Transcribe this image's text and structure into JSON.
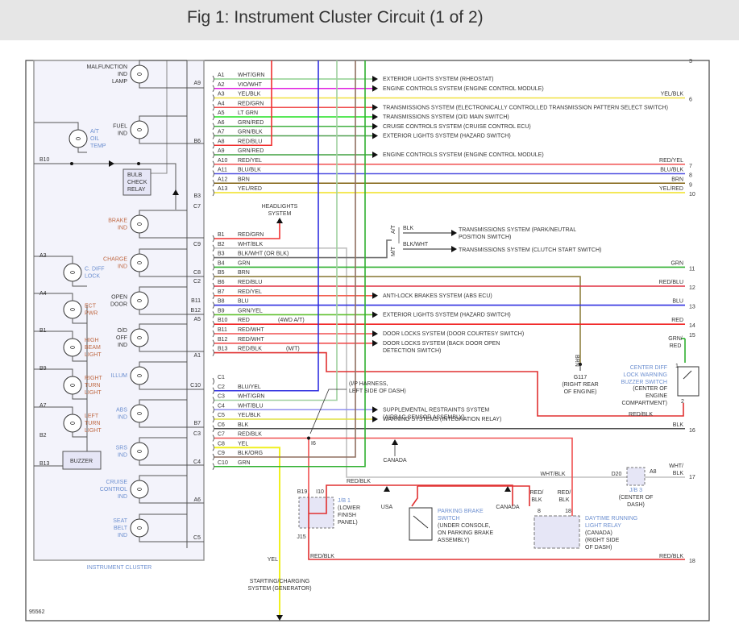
{
  "header": {
    "title": "Fig 1: Instrument Cluster Circuit (1 of 2)"
  },
  "figure_id": "95562",
  "cluster": {
    "label": "INSTRUMENT CLUSTER",
    "indicators": [
      {
        "name": "MALFUNCTION|IND|LAMP"
      },
      {
        "name": "FUEL|IND"
      },
      {
        "name": "A/T|OIL|TEMP"
      },
      {
        "name": "BRAKE|IND"
      },
      {
        "name": "CHARGE|IND"
      },
      {
        "name": "C. DIFF|LOCK"
      },
      {
        "name": "ECT|PWR"
      },
      {
        "name": "OPEN|DOOR"
      },
      {
        "name": "O/D|OFF|IND"
      },
      {
        "name": "HIGH|BEAM|LIGHT"
      },
      {
        "name": "ILLUM"
      },
      {
        "name": "RIGHT|TURN|LIGHT"
      },
      {
        "name": "ABS|IND"
      },
      {
        "name": "LEFT|TURN|LIGHT"
      },
      {
        "name": "SRS|IND"
      },
      {
        "name": "CRUISE|CONTROL|IND"
      },
      {
        "name": "SEAT|BELT|IND"
      }
    ],
    "bulb_check_relay": "BULB|CHECK|RELAY",
    "buzzer": "BUZZER",
    "right_pins": [
      "A9",
      "B6",
      "B3",
      "C7",
      "C9",
      "C8",
      "C2",
      "B11",
      "B12",
      "A5",
      "A1",
      "C10",
      "B7",
      "C3",
      "C4",
      "A6",
      "C5"
    ],
    "left_pins": [
      "B10",
      "A3",
      "A4",
      "B1",
      "B9",
      "A7",
      "B2",
      "B13"
    ]
  },
  "connectors": [
    {
      "pin": "A1",
      "wire": "WHT/GRN",
      "color": "#8fd08f",
      "dest": "EXTERIOR LIGHTS SYSTEM (RHEOSTAT)"
    },
    {
      "pin": "A2",
      "wire": "VIO/WHT",
      "color": "#e020e0",
      "dest": "ENGINE CONTROLS SYSTEM (ENGINE CONTROL MODULE)"
    },
    {
      "pin": "A3",
      "wire": "YEL/BLK",
      "color": "#f0e040",
      "right": "YEL/BLK",
      "num": "6"
    },
    {
      "pin": "A4",
      "wire": "RED/GRN",
      "color": "#f05050",
      "dest": "TRANSMISSIONS SYSTEM (ELECTRONICALLY CONTROLLED TRANSMISSION PATTERN SELECT SWITCH)"
    },
    {
      "pin": "A5",
      "wire": "LT GRN",
      "color": "#20e020",
      "dest": "TRANSMISSIONS SYSTEM (O/D MAIN SWITCH)"
    },
    {
      "pin": "A6",
      "wire": "GRN/RED",
      "color": "#40b040",
      "dest": "CRUISE CONTROLS SYSTEM (CRUISE CONTROL ECU)"
    },
    {
      "pin": "A7",
      "wire": "GRN/BLK",
      "color": "#50a050",
      "dest": "EXTERIOR LIGHTS SYSTEM (HAZARD SWITCH)"
    },
    {
      "pin": "A8",
      "wire": "RED/BLU",
      "color": "#f03030"
    },
    {
      "pin": "A9",
      "wire": "GRN/RED",
      "color": "#40a040",
      "dest": "ENGINE CONTROLS SYSTEM (ENGINE CONTROL MODULE)"
    },
    {
      "pin": "A10",
      "wire": "RED/YEL",
      "color": "#f05050",
      "right": "RED/YEL",
      "num": "7"
    },
    {
      "pin": "A11",
      "wire": "BLU/BLK",
      "color": "#5050e0",
      "right": "BLU/BLK",
      "num": "8"
    },
    {
      "pin": "A12",
      "wire": "BRN",
      "color": "#806010",
      "right": "BRN",
      "num": "9"
    },
    {
      "pin": "A13",
      "wire": "YEL/RED",
      "color": "#f0e020",
      "right": "YEL/RED",
      "num": "10"
    },
    {
      "pin": "B1",
      "wire": "RED/GRN",
      "color": "#f03030"
    },
    {
      "pin": "B2",
      "wire": "WHT/BLK",
      "color": "#c0c0c0"
    },
    {
      "pin": "B3",
      "wire": "BLK/WHT (OR BLK)",
      "color": "#707070"
    },
    {
      "pin": "B4",
      "wire": "GRN",
      "color": "#30b030",
      "right": "GRN",
      "num": "11"
    },
    {
      "pin": "B5",
      "wire": "BRN",
      "color": "#908040"
    },
    {
      "pin": "B6",
      "wire": "RED/BLU",
      "color": "#e03040",
      "right": "RED/BLU",
      "num": "12"
    },
    {
      "pin": "B7",
      "wire": "RED/YEL",
      "color": "#f06050",
      "dest": "ANTI-LOCK BRAKES SYSTEM (ABS ECU)"
    },
    {
      "pin": "B8",
      "wire": "BLU",
      "color": "#3030e0",
      "right": "BLU",
      "num": "13"
    },
    {
      "pin": "B9",
      "wire": "GRN/YEL",
      "color": "#60c030",
      "dest": "EXTERIOR LIGHTS SYSTEM (HAZARD SWITCH)"
    },
    {
      "pin": "B10",
      "wire": "RED",
      "color": "#f02020",
      "note": "(4WD A/T)",
      "right": "RED",
      "num": "14"
    },
    {
      "pin": "B11",
      "wire": "RED/WHT",
      "color": "#f05050",
      "dest": "DOOR LOCKS SYSTEM (DOOR COURTESY SWITCH)"
    },
    {
      "pin": "B12",
      "wire": "RED/WHT",
      "color": "#f05050",
      "dest": "DOOR LOCKS SYSTEM (BACK DOOR OPEN|DETECTION SWITCH)"
    },
    {
      "pin": "B13",
      "wire": "RED/BLK",
      "color": "#e03030",
      "note": "(M/T)"
    },
    {
      "pin": "C1",
      "wire": "",
      "color": ""
    },
    {
      "pin": "C2",
      "wire": "BLU/YEL",
      "color": "#3030e0"
    },
    {
      "pin": "C3",
      "wire": "WHT/GRN",
      "color": "#a0d0a0"
    },
    {
      "pin": "C4",
      "wire": "WHT/BLU",
      "color": "#9090f0",
      "dest": "SUPPLEMENTAL RESTRAINTS SYSTEM|(AIRBAG SENSOR ASSEMBLY)"
    },
    {
      "pin": "C5",
      "wire": "YEL/BLK",
      "color": "#e0e040",
      "dest": "WARNING SYSTEMS (INTEGRATION RELAY)"
    },
    {
      "pin": "C6",
      "wire": "BLK",
      "color": "#505050",
      "right": "BLK",
      "num": "16"
    },
    {
      "pin": "C7",
      "wire": "RED/BLK",
      "color": "#f05050"
    },
    {
      "pin": "C8",
      "wire": "YEL",
      "color": "#f0f020"
    },
    {
      "pin": "C9",
      "wire": "BLK/ORG",
      "color": "#907060"
    },
    {
      "pin": "C10",
      "wire": "GRN",
      "color": "#30b030"
    }
  ],
  "labels": {
    "headlights": "HEADLIGHTS|SYSTEM",
    "at": "A/T",
    "mt": "M/T",
    "blk": "BLK",
    "blk_wht": "BLK/WHT",
    "trans_park": "TRANSMISSIONS SYSTEM (PARK/NEUTRAL|POSITION SWITCH)",
    "trans_clutch": "TRANSMISSIONS SYSTEM (CLUTCH START SWITCH)",
    "brn_vert": "BRN",
    "g117": "G117|(RIGHT REAR|OF ENGINE)",
    "grn_red": "GRN/|RED",
    "num15": "15",
    "center_diff": "CENTER DIFF|LOCK WARNING|BUZZER SWITCH",
    "center_diff_loc": "(CENTER OF|ENGINE|COMPARTMENT)",
    "pin1": "1",
    "pin2": "2",
    "red_blk_1": "RED/BLK",
    "ip_harness": "(I/P HARNESS,|LEFT SIDE OF DASH)",
    "i6": "I6",
    "canada1": "CANADA",
    "canada2": "CANADA",
    "usa": "USA",
    "wht_blk": "WHT/BLK",
    "d20": "D20",
    "a8": "A8",
    "wht_blk_r": "WHT/|BLK",
    "num17": "17",
    "jb3": "J/B 3",
    "jb3_loc": "(CENTER OF|DASH)",
    "red_blk_2": "RED/BLK",
    "b19": "B19",
    "i10": "I10",
    "j15": "J15",
    "jb1": "J/B 1",
    "jb1_loc": "(LOWER|FINISH|PANEL)",
    "parking_brake": "PARKING BRAKE|SWITCH",
    "parking_brake_loc": "(UNDER CONSOLE,|ON PARKING BRAKE|ASSEMBLY)",
    "red_blk_8": "RED/|BLK",
    "red_blk_18": "RED/|BLK",
    "pin8": "8",
    "pin18": "18",
    "drl": "DAYTIME RUNNING|LIGHT RELAY",
    "drl_loc": "(CANADA)|(RIGHT SIDE|OF DASH)",
    "red_blk_3": "RED/BLK",
    "red_blk_4": "RED/BLK",
    "num18": "18",
    "yel": "YEL",
    "starting": "STARTING/CHARGING|SYSTEM (GENERATOR)",
    "num3": "3"
  }
}
